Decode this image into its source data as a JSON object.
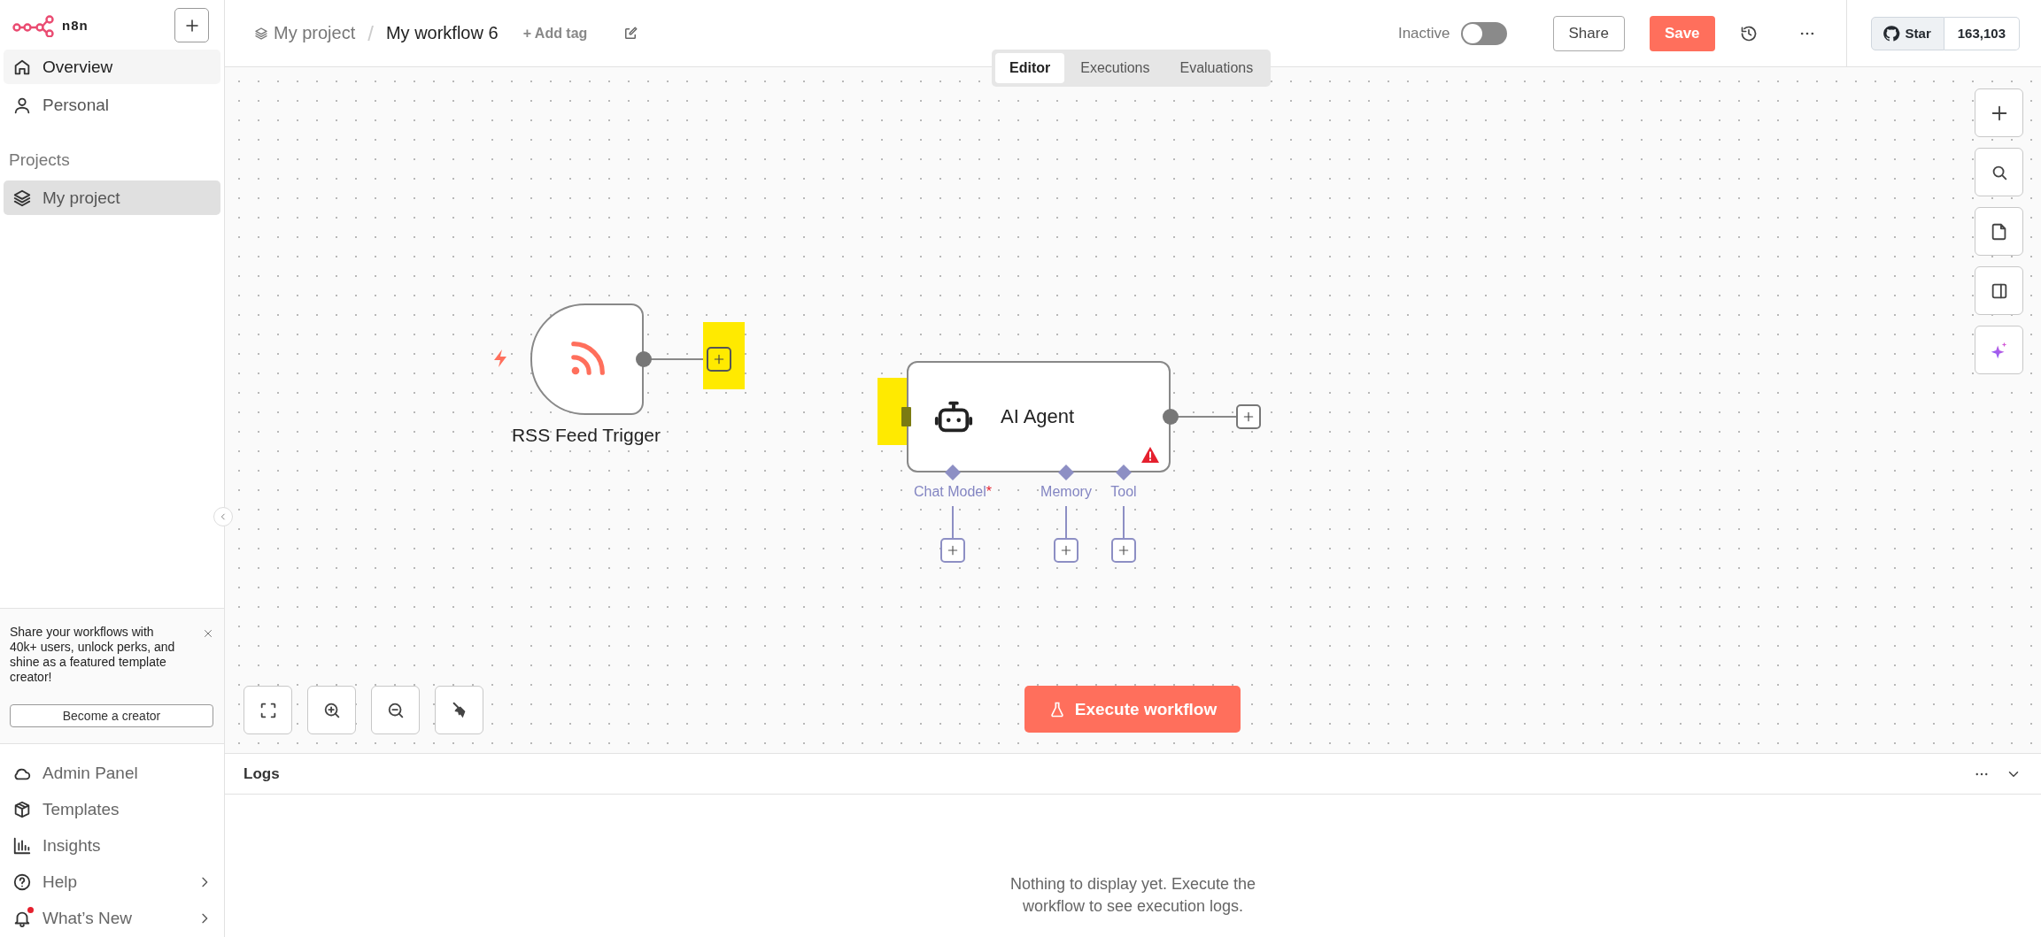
{
  "sidebar": {
    "logo_text": "n8n",
    "nav": [
      {
        "label": "Overview",
        "selected": false,
        "hovered": true
      },
      {
        "label": "Personal",
        "selected": false,
        "hovered": false
      }
    ],
    "section_title": "Projects",
    "projects": [
      {
        "label": "My project",
        "selected": true
      }
    ],
    "promo": {
      "text": "Share your workflows with 40k+ users, unlock perks, and shine as a featured template creator!",
      "button": "Become a creator"
    },
    "footer": [
      {
        "label": "Admin Panel",
        "has_submenu": false,
        "notification": false
      },
      {
        "label": "Templates",
        "has_submenu": false,
        "notification": false
      },
      {
        "label": "Insights",
        "has_submenu": false,
        "notification": false
      },
      {
        "label": "Help",
        "has_submenu": true,
        "notification": false
      },
      {
        "label": "What’s New",
        "has_submenu": true,
        "notification": true
      }
    ]
  },
  "header": {
    "project": "My project",
    "separator": "/",
    "workflow": "My workflow 6",
    "add_tag": "+ Add tag",
    "status": "Inactive",
    "active": false,
    "share": "Share",
    "save": "Save",
    "github": {
      "label": "Star",
      "count": "163,103"
    }
  },
  "view_tabs": [
    {
      "label": "Editor",
      "selected": true
    },
    {
      "label": "Executions",
      "selected": false
    },
    {
      "label": "Evaluations",
      "selected": false
    }
  ],
  "canvas": {
    "nodes": [
      {
        "kind": "trigger",
        "label": "RSS Feed Trigger"
      },
      {
        "kind": "agent",
        "label": "AI Agent",
        "warning": true,
        "inputs": [
          {
            "label": "Chat Model",
            "marker": "*"
          },
          {
            "label": "Memory"
          },
          {
            "label": "Tool"
          }
        ]
      }
    ],
    "execute_button": "Execute workflow"
  },
  "logs": {
    "title": "Logs",
    "empty_message": "Nothing to display yet. Execute the workflow to see execution logs."
  }
}
